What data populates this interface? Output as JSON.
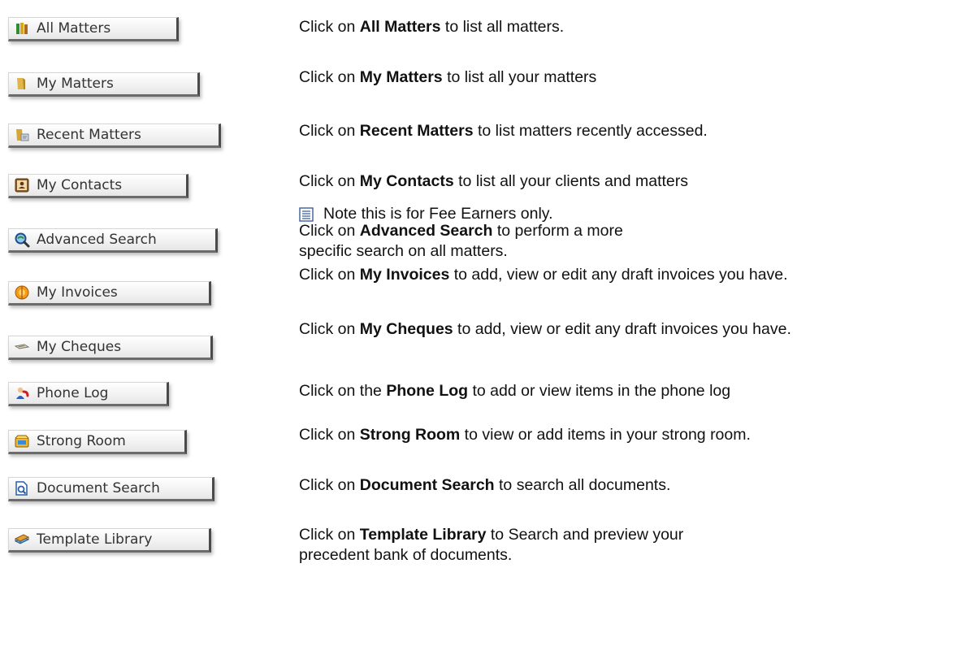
{
  "items": [
    {
      "label": "All Matters",
      "icon": "folder-books-icon",
      "pre": "Click on ",
      "bold": "All Matters",
      "post": " to list all matters."
    },
    {
      "label": "My Matters",
      "icon": "folder-icon",
      "pre": "Click on ",
      "bold": "My Matters",
      "post": " to list all your matters"
    },
    {
      "label": "Recent Matters",
      "icon": "recent-folder-icon",
      "pre": "Click on ",
      "bold": "Recent Matters",
      "post": " to list matters recently accessed."
    },
    {
      "label": "My Contacts",
      "icon": "contact-card-icon",
      "pre": "Click on ",
      "bold": "My Contacts",
      "post": " to  list all your clients and matters"
    },
    {
      "label": "Advanced Search",
      "icon": "advanced-search-icon",
      "pre": "Click on ",
      "bold": "Advanced Search",
      "post": " to perform a more specific search on all matters."
    },
    {
      "label": "My Invoices",
      "icon": "invoice-icon",
      "pre": "Click on ",
      "bold": "My Invoices",
      "post": " to add, view or edit any draft invoices you have."
    },
    {
      "label": "My Cheques",
      "icon": "cheque-icon",
      "pre": "Click on ",
      "bold": "My Cheques",
      "post": " to add, view or edit any draft invoices you have."
    },
    {
      "label": "Phone Log",
      "icon": "phone-user-icon",
      "pre": "Click on the ",
      "bold": "Phone Log",
      "post": " to add or view items in the phone log"
    },
    {
      "label": "Strong Room",
      "icon": "strong-room-icon",
      "pre": "Click on ",
      "bold": "Strong Room",
      "post": " to view or add items in your strong room."
    },
    {
      "label": "Document Search",
      "icon": "document-search-icon",
      "pre": "Click on ",
      "bold": "Document Search",
      "post": " to search all documents."
    },
    {
      "label": "Template Library",
      "icon": "template-library-icon",
      "pre": "Click on ",
      "bold": "Template Library",
      "post": " to Search and preview your precedent bank of documents."
    }
  ],
  "note": {
    "icon": "note-icon",
    "text": "Note this is for Fee Earners only."
  }
}
